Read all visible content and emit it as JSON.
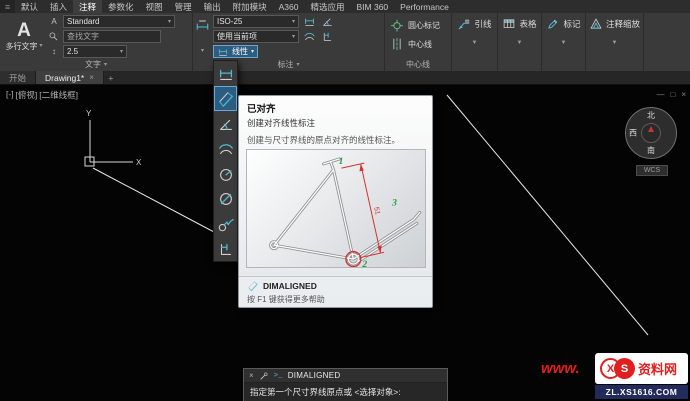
{
  "colors": {
    "accent_teal": "#53b9d1",
    "centerline_green": "#62c48c",
    "selection_blue": "#2b5d80",
    "dimension_red": "#d23232",
    "label_green": "#2f9e44",
    "watermark_red": "#e02020",
    "watermark_navy": "#232a5c"
  },
  "ribbon": {
    "app_menu_glyph": "≡",
    "tabs": [
      "默认",
      "插入",
      "注释",
      "参数化",
      "视图",
      "管理",
      "输出",
      "附加模块",
      "A360",
      "精选应用",
      "BIM 360",
      "Performance"
    ],
    "active_tab": "注释",
    "text_panel": {
      "mtext_label": "多行文字",
      "style_value": "Standard",
      "find_text": "查找文字",
      "text_height": "2.5",
      "panel_label": "文字"
    },
    "dim_panel": {
      "dim_style_value": "ISO-25",
      "dim_layer_value": "使用当前项",
      "linear_label": "线性",
      "panel_label": "标注"
    },
    "center_panel": {
      "center_mark_label": "圆心标记",
      "centerline_label": "中心线",
      "panel_label": "中心线"
    },
    "leader_panel_label": "引线",
    "table_panel_label": "表格",
    "markup_panel_label": "标记",
    "annoscale_panel_label": "注释缩放"
  },
  "file_tabs": {
    "start_tab": "开始",
    "drawing_tab": "Drawing1*",
    "close_glyph": "×",
    "new_tab_glyph": "+"
  },
  "viewport": {
    "vp_controls": {
      "menu": "[-]",
      "view": "[俯视]",
      "visual_style": "[二维线框]"
    },
    "ucs": {
      "x_label": "X",
      "y_label": "Y"
    },
    "viewcube": {
      "north": "北",
      "west": "西",
      "south": "南",
      "wcs_label": "WCS"
    },
    "window_controls": {
      "minimize": "—",
      "restore": "□",
      "close": "×"
    }
  },
  "dim_dropdown": {
    "selected": "已对齐",
    "icons": [
      "linear-dimension-icon",
      "aligned-dimension-icon",
      "angular-dimension-icon",
      "arc-length-dimension-icon",
      "radius-dimension-icon",
      "diameter-dimension-icon",
      "jogged-dimension-icon",
      "ordinate-dimension-icon"
    ]
  },
  "tooltip": {
    "title": "已对齐",
    "subtitle": "创建对齐线性标注",
    "description": "创建与尺寸界线的原点对齐的线性标注。",
    "figure": {
      "point1": "1",
      "point2": "2",
      "point3": "3",
      "dim_text": "51"
    },
    "command": "DIMALIGNED",
    "help": "按 F1 键获得更多帮助"
  },
  "command_line": {
    "prompt_glyph": "&gt;_",
    "command": "DIMALIGNED",
    "prompt": "指定第一个尺寸界线原点或 <选择对象>:"
  },
  "watermark": {
    "www": "www.",
    "logo_x": "X",
    "logo_s": "S",
    "site_name": "资料网",
    "domain": "ZL.XS1616.COM"
  }
}
